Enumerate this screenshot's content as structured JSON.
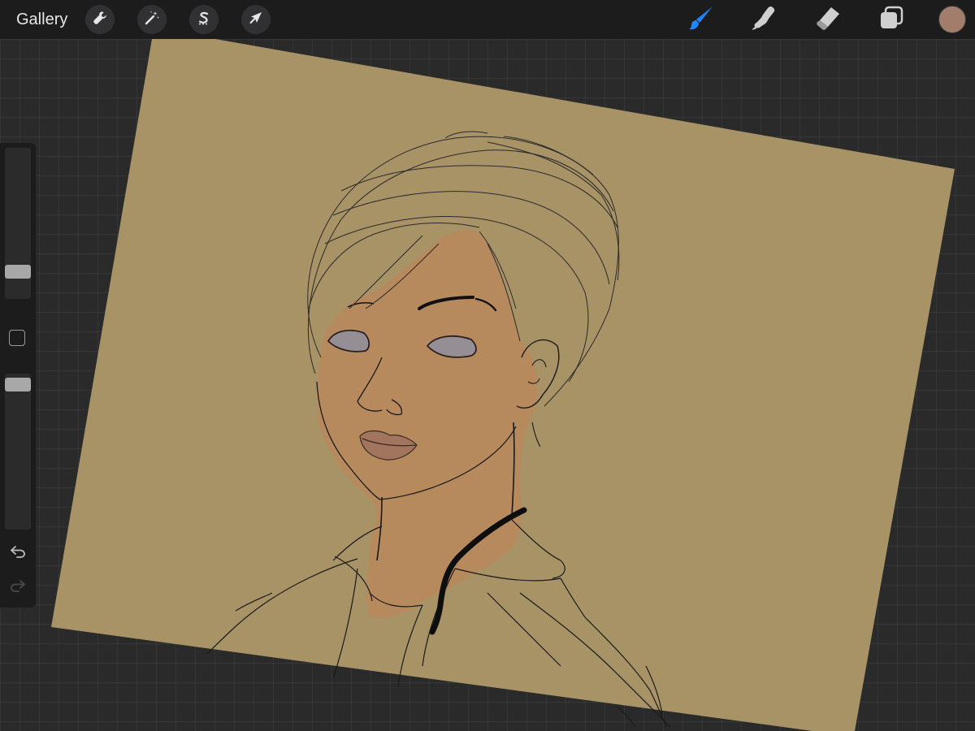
{
  "app": {
    "gallery_label": "Gallery"
  },
  "toolbar": {
    "left_tools": [
      {
        "name": "actions",
        "icon": "wrench-icon"
      },
      {
        "name": "adjustments",
        "icon": "magic-wand-icon"
      },
      {
        "name": "selection",
        "icon": "selection-s-icon"
      },
      {
        "name": "transform",
        "icon": "arrow-cursor-icon"
      }
    ],
    "right_tools": [
      {
        "name": "brush",
        "icon": "brush-icon",
        "active": true
      },
      {
        "name": "smudge",
        "icon": "smudge-finger-icon",
        "active": false
      },
      {
        "name": "eraser",
        "icon": "eraser-icon",
        "active": false
      },
      {
        "name": "layers",
        "icon": "layers-icon",
        "active": false
      }
    ]
  },
  "colors": {
    "active_color": "#a27d6b",
    "accent": "#1e86ff",
    "canvas_paper": "#a89366",
    "skin": "#b8895d",
    "lips": "#a2765e",
    "eyes": "#958e94"
  },
  "sidebar": {
    "brush_size_level": 0.15,
    "opacity_level": 0.97,
    "undo_icon": "undo-icon",
    "redo_icon": "redo-icon",
    "redo_enabled": false
  }
}
